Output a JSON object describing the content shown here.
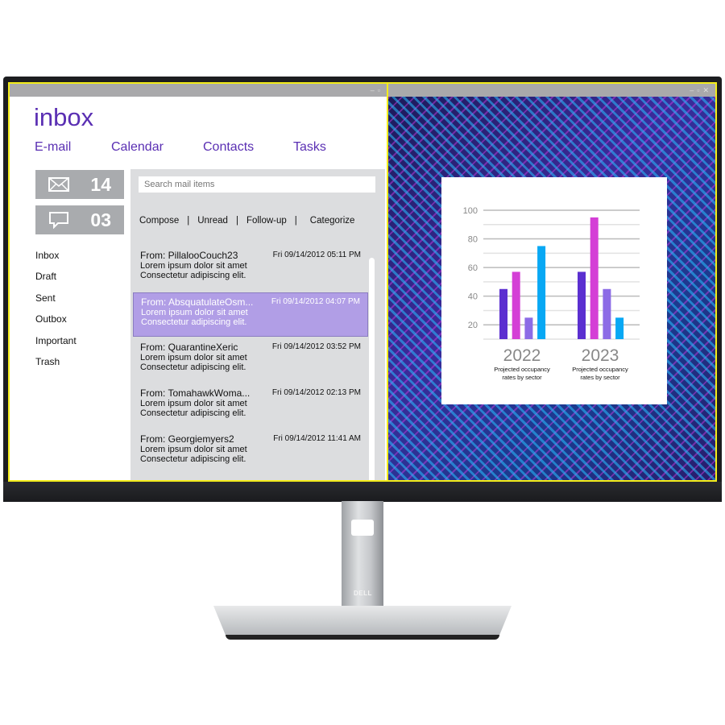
{
  "brand": "DELL",
  "left_window": {
    "title": "inbox",
    "nav": [
      "E-mail",
      "Calendar",
      "Contacts",
      "Tasks"
    ],
    "tiles": [
      {
        "icon": "envelope-icon",
        "count": "14"
      },
      {
        "icon": "chat-bubble-icon",
        "count": "03"
      }
    ],
    "folders": [
      "Inbox",
      "Draft",
      "Sent",
      "Outbox",
      "Important",
      "Trash"
    ],
    "search_placeholder": "Search mail items",
    "actions": [
      "Compose",
      "|",
      "Unread",
      "|",
      "Follow-up",
      "|",
      "Categorize"
    ],
    "mails": [
      {
        "from": "From: PillalooCouch23",
        "date": "Fri 09/14/2012 05:11 PM",
        "line1": "Lorem ipsum dolor sit amet",
        "line2": "Consectetur adipiscing elit."
      },
      {
        "from": "From: AbsquatulateOsm...",
        "date": "Fri 09/14/2012 04:07 PM",
        "line1": "Lorem ipsum dolor sit amet",
        "line2": "Consectetur adipiscing elit.",
        "selected": true
      },
      {
        "from": "From: QuarantineXeric",
        "date": "Fri 09/14/2012 03:52 PM",
        "line1": "Lorem ipsum dolor sit amet",
        "line2": "Consectetur adipiscing elit."
      },
      {
        "from": "From: TomahawkWoma...",
        "date": "Fri 09/14/2012 02:13 PM",
        "line1": "Lorem ipsum dolor sit amet",
        "line2": "Consectetur adipiscing elit."
      },
      {
        "from": "From: Georgiemyers2",
        "date": "Fri 09/14/2012 11:41 AM",
        "line1": "Lorem ipsum dolor sit amet",
        "line2": "Consectetur adipiscing elit."
      }
    ],
    "accent": "#5a2fb3",
    "selected_color": "#b19ee6"
  },
  "chart_data": {
    "type": "bar",
    "categories": [
      "2022",
      "2023"
    ],
    "category_captions": [
      "Projected occupancy rates by sector",
      "Projected occupancy rates by sector"
    ],
    "series": [
      {
        "color": "#5b2fd0",
        "values": [
          45,
          57
        ]
      },
      {
        "color": "#d43fd6",
        "values": [
          57,
          95
        ]
      },
      {
        "color": "#8c6be6",
        "values": [
          25,
          45
        ]
      },
      {
        "color": "#08a8f4",
        "values": [
          75,
          25
        ]
      }
    ],
    "yticks": [
      20,
      40,
      60,
      80,
      100
    ],
    "ylim": [
      10,
      100
    ],
    "grid": true
  }
}
